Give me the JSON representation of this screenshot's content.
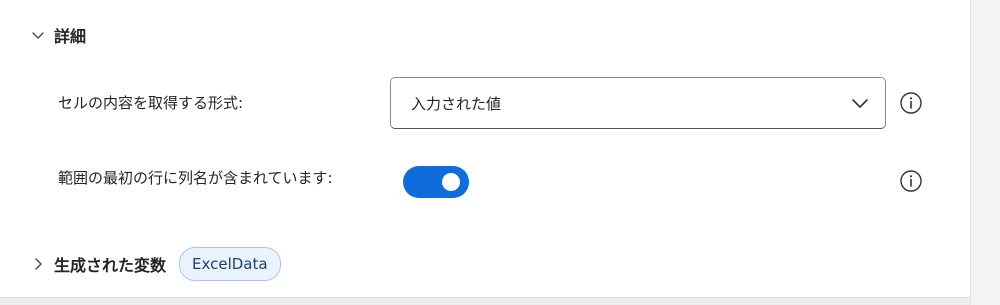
{
  "details": {
    "title": "詳細",
    "expanded": true
  },
  "cell_format": {
    "label": "セルの内容を取得する形式:",
    "selected_value": "入力された値"
  },
  "header_row": {
    "label": "範囲の最初の行に列名が含まれています:",
    "enabled": true
  },
  "variables": {
    "title": "生成された変数",
    "chip": "ExcelData"
  },
  "colors": {
    "toggle_on": "#0f6cdb",
    "chip_background": "#eaf2fc",
    "chip_border": "#a9c7ef"
  },
  "icons": {
    "section_expanded": "chevron-down-icon",
    "section_collapsed": "chevron-right-icon",
    "dropdown": "chevron-down-icon",
    "info": "info-icon"
  }
}
